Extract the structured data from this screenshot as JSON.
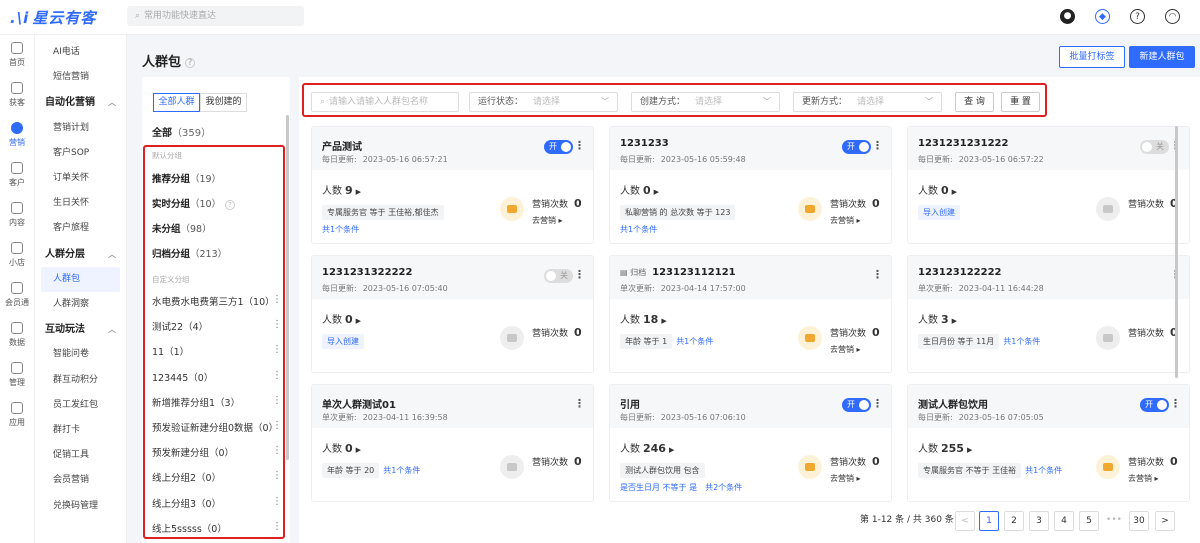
{
  "app": {
    "brand": "星云有客",
    "search_placeholder": "常用功能快速直达"
  },
  "topicons": [
    {
      "name": "avatar",
      "color": "#222",
      "glyph": "●"
    },
    {
      "name": "shield-icon",
      "color": "#2f6bff",
      "glyph": "◆"
    },
    {
      "name": "help-icon",
      "color": "#333",
      "glyph": "?"
    },
    {
      "name": "headset-icon",
      "color": "#333",
      "glyph": "◠"
    }
  ],
  "leftnav": [
    {
      "label": "首页",
      "active": false
    },
    {
      "label": "获客",
      "active": false
    },
    {
      "label": "营销",
      "active": true
    },
    {
      "label": "客户",
      "active": false
    },
    {
      "label": "内容",
      "active": false
    },
    {
      "label": "小店",
      "active": false
    },
    {
      "label": "会员通",
      "active": false
    },
    {
      "label": "数据",
      "active": false
    },
    {
      "label": "管理",
      "active": false
    },
    {
      "label": "应用",
      "active": false
    }
  ],
  "submenu": [
    {
      "type": "item",
      "label": "AI电话"
    },
    {
      "type": "item",
      "label": "短信营销"
    },
    {
      "type": "head",
      "label": "自动化营销"
    },
    {
      "type": "item",
      "label": "营销计划"
    },
    {
      "type": "item",
      "label": "客户SOP"
    },
    {
      "type": "item",
      "label": "订单关怀"
    },
    {
      "type": "item",
      "label": "生日关怀"
    },
    {
      "type": "item",
      "label": "客户旅程"
    },
    {
      "type": "head",
      "label": "人群分层"
    },
    {
      "type": "item",
      "label": "人群包",
      "active": true
    },
    {
      "type": "item",
      "label": "人群洞察"
    },
    {
      "type": "head",
      "label": "互动玩法"
    },
    {
      "type": "item",
      "label": "智能问卷"
    },
    {
      "type": "item",
      "label": "群互动积分"
    },
    {
      "type": "item",
      "label": "员工发红包"
    },
    {
      "type": "item",
      "label": "群打卡"
    },
    {
      "type": "item",
      "label": "促销工具"
    },
    {
      "type": "item",
      "label": "会员营销"
    },
    {
      "type": "item",
      "label": "兑换码管理"
    }
  ],
  "page": {
    "title": "人群包",
    "help": "?",
    "batch_tag_button": "批量打标签",
    "new_group_button": "新建人群包"
  },
  "groups": {
    "tabs": [
      "全部人群",
      "我创建的"
    ],
    "all": {
      "label": "全部",
      "count": "（359）"
    },
    "default_label": "默认分组",
    "default": [
      {
        "label": "推荐分组",
        "count": "（19）"
      },
      {
        "label": "实时分组",
        "count": "（10）",
        "help": "?"
      },
      {
        "label": "未分组",
        "count": "（98）"
      },
      {
        "label": "归档分组",
        "count": "（213）"
      }
    ],
    "custom_label": "自定义分组",
    "custom": [
      {
        "label": "水电费水电费第三方1（10）"
      },
      {
        "label": "测试22（4）"
      },
      {
        "label": "11（1）"
      },
      {
        "label": "123445（0）"
      },
      {
        "label": "新增推荐分组1（3）"
      },
      {
        "label": "预发验证新建分组0数据（0）"
      },
      {
        "label": "预发新建分组（0）"
      },
      {
        "label": "线上分组2（0）"
      },
      {
        "label": "线上分组3（0）"
      },
      {
        "label": "线上5sssss（0）"
      }
    ]
  },
  "filters": {
    "name_placeholder": "请输入请输入人群包名称",
    "status_label": "运行状态：",
    "create_label": "创建方式：",
    "update_label": "更新方式：",
    "select_placeholder": "请选择",
    "query_button": "查 询",
    "reset_button": "重 置"
  },
  "cards": [
    {
      "title": "产品测试",
      "tag": "",
      "upd_label": "每日更新:",
      "upd": "2023-05-16 06:57:21",
      "toggle": "开",
      "toggle_on": true,
      "people_label": "人数",
      "people": "9",
      "cond": "专属服务官 等于 王佳裕,郁佳杰",
      "cond_link": "",
      "link_row": "共1个条件",
      "import": "",
      "mk_label": "营销次数",
      "mk": "0",
      "go": "去营销 ▸",
      "mk_active": true
    },
    {
      "title": "1231233",
      "tag": "",
      "upd_label": "每日更新:",
      "upd": "2023-05-16 05:59:48",
      "toggle": "开",
      "toggle_on": true,
      "people_label": "人数",
      "people": "0",
      "cond": "私聊营销 的 总次数 等于 123",
      "cond_link": "",
      "link_row": "共1个条件",
      "import": "",
      "mk_label": "营销次数",
      "mk": "0",
      "go": "去营销 ▸",
      "mk_active": true
    },
    {
      "title": "1231231231222",
      "tag": "",
      "upd_label": "每日更新:",
      "upd": "2023-05-16 06:57:22",
      "toggle": "关",
      "toggle_on": false,
      "people_label": "人数",
      "people": "0",
      "cond": "",
      "cond_link": "",
      "link_row": "",
      "import": "导入创建",
      "mk_label": "营销次数",
      "mk": "0",
      "go": "",
      "mk_active": false
    },
    {
      "title": "1231231322222",
      "tag": "",
      "upd_label": "每日更新:",
      "upd": "2023-05-16 07:05:40",
      "toggle": "关",
      "toggle_on": false,
      "people_label": "人数",
      "people": "0",
      "cond": "",
      "cond_link": "",
      "link_row": "",
      "import": "导入创建",
      "mk_label": "营销次数",
      "mk": "0",
      "go": "",
      "mk_active": false
    },
    {
      "title": "123123112121",
      "tag": "归档",
      "upd_label": "单次更新:",
      "upd": "2023-04-14 17:57:00",
      "toggle": "",
      "toggle_on": null,
      "people_label": "人数",
      "people": "18",
      "cond": "年龄 等于 1",
      "cond_link": "共1个条件",
      "link_row": "",
      "import": "",
      "mk_label": "营销次数",
      "mk": "0",
      "go": "去营销 ▸",
      "mk_active": true
    },
    {
      "title": "123123122222",
      "tag": "",
      "upd_label": "单次更新:",
      "upd": "2023-04-11 16:44:28",
      "toggle": "",
      "toggle_on": null,
      "people_label": "人数",
      "people": "3",
      "cond": "生日月份 等于 11月",
      "cond_link": "共1个条件",
      "link_row": "",
      "import": "",
      "mk_label": "营销次数",
      "mk": "0",
      "go": "",
      "mk_active": false
    },
    {
      "title": "单次人群测试01",
      "tag": "",
      "upd_label": "单次更新:",
      "upd": "2023-04-11 16:39:58",
      "toggle": "",
      "toggle_on": null,
      "people_label": "人数",
      "people": "0",
      "cond": "年龄 等于 20",
      "cond_link": "共1个条件",
      "link_row": "",
      "import": "",
      "mk_label": "营销次数",
      "mk": "0",
      "go": "",
      "mk_active": false
    },
    {
      "title": "引用",
      "tag": "",
      "upd_label": "每日更新:",
      "upd": "2023-05-16 07:06:10",
      "toggle": "开",
      "toggle_on": true,
      "people_label": "人数",
      "people": "246",
      "cond": "测试人群包饮用 包含",
      "cond_link": "",
      "link_row": "是否生日月 不等于 是　共2个条件",
      "import": "",
      "mk_label": "营销次数",
      "mk": "0",
      "go": "去营销 ▸",
      "mk_active": true
    },
    {
      "title": "测试人群包饮用",
      "tag": "",
      "upd_label": "每日更新:",
      "upd": "2023-05-16 07:05:05",
      "toggle": "开",
      "toggle_on": true,
      "people_label": "人数",
      "people": "255",
      "cond": "专属服务官 不等于 王佳裕",
      "cond_link": "共1个条件",
      "link_row": "",
      "import": "",
      "mk_label": "营销次数",
      "mk": "0",
      "go": "去营销 ▸",
      "mk_active": true
    }
  ],
  "pager": {
    "summary": "第 1-12 条 / 共 360 条",
    "prev": "<",
    "next": ">",
    "pages": [
      "1",
      "2",
      "3",
      "4",
      "5",
      "•••",
      "30"
    ],
    "current": "1"
  }
}
